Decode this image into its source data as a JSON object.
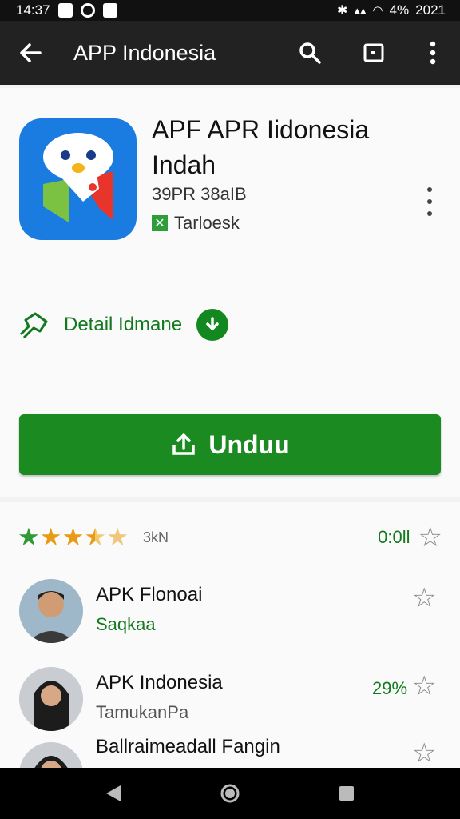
{
  "status_bar": {
    "time": "14:37",
    "battery": "4%",
    "right_time": "2021"
  },
  "toolbar": {
    "title": "APP Indonesia"
  },
  "app": {
    "title": "APF APR Iidonesia Indah",
    "developer": "39PR 38aIB",
    "category": "Tarloesk",
    "detail_label": "Detail Idmane",
    "install_label": "Unduu"
  },
  "rating": {
    "count": "3kN",
    "score": "0:0ll",
    "stars": 4.5
  },
  "reviews": [
    {
      "name": "APK Flonoai",
      "sub": "Saqkaa",
      "sub_color": "#13791f",
      "pct": ""
    },
    {
      "name": "APK Indonesia",
      "sub": "TamukanPa",
      "sub_color": "#555555",
      "pct": "29%"
    },
    {
      "name": "Ballraimeadall Fangin",
      "sub": "",
      "sub_color": "#555555",
      "pct": ""
    }
  ],
  "colors": {
    "accent": "#1a8a21",
    "toolbar": "#222222",
    "icon_blue": "#1a7be0"
  },
  "icons": [
    "back-arrow-icon",
    "search-icon",
    "cast-icon",
    "more-vert-icon",
    "download-icon",
    "upload-icon",
    "star-icon"
  ]
}
